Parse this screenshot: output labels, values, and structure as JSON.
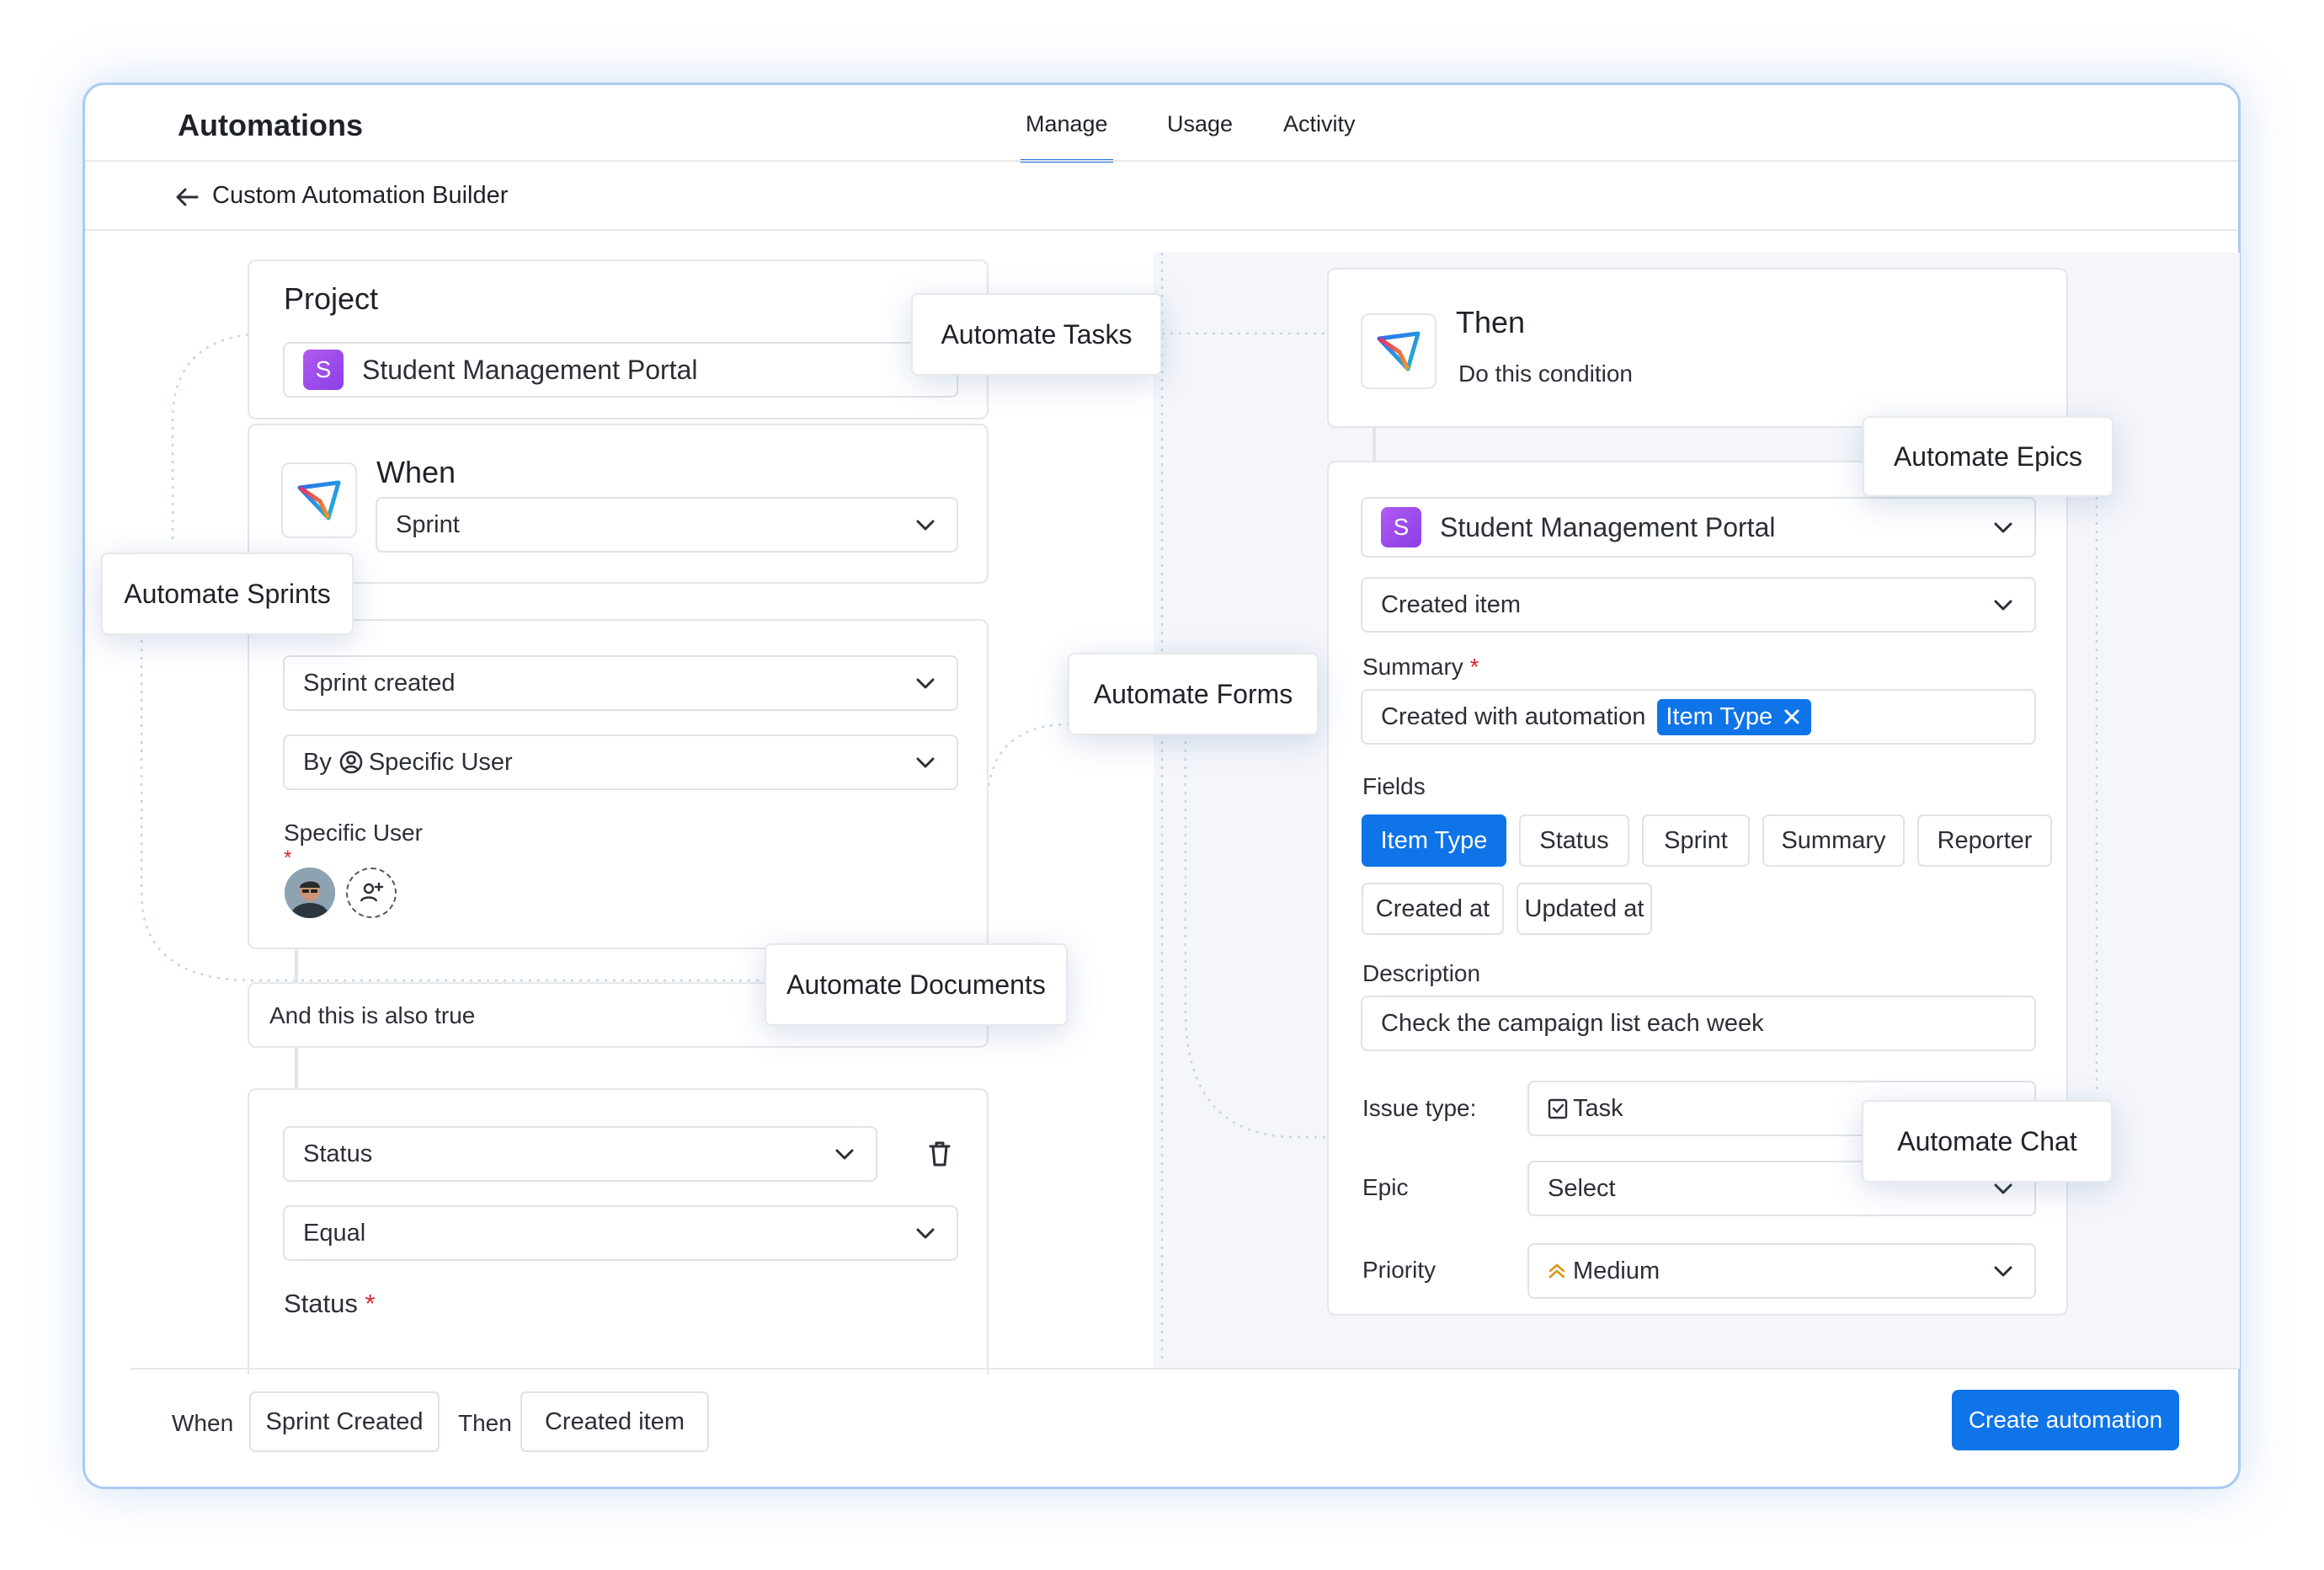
{
  "header": {
    "app_title": "Automations",
    "tabs": [
      "Manage",
      "Usage",
      "Activity"
    ],
    "active_tab": "Manage",
    "breadcrumb": "Custom Automation Builder"
  },
  "left": {
    "project_title": "Project",
    "project_name": "Student Management Portal",
    "project_badge": "S",
    "when_title": "When",
    "when_select": "Sprint",
    "trigger_select": "Sprint created",
    "by_prefix": "By",
    "by_user": "Specific User",
    "specific_user_label": "Specific User",
    "asterisk": "*",
    "and_also_true": "And this is also true",
    "status_select": "Status",
    "equal_select": "Equal",
    "status_label": "Status"
  },
  "right": {
    "then_title": "Then",
    "then_subtitle": "Do this condition",
    "project_name": "Student Management Portal",
    "project_badge": "S",
    "action_select": "Created item",
    "summary_label": "Summary",
    "summary_text": "Created with automation",
    "summary_token": "Item Type",
    "fields_label": "Fields",
    "field_chips": [
      "Item Type",
      "Status",
      "Sprint",
      "Summary",
      "Reporter",
      "Created at",
      "Updated at"
    ],
    "description_label": "Description",
    "description_value": "Check the campaign list each week",
    "issue_type_label": "Issue type:",
    "issue_type_value": "Task",
    "epic_label": "Epic",
    "epic_value": "Select",
    "priority_label": "Priority",
    "priority_value": "Medium"
  },
  "callouts": {
    "tasks": "Automate Tasks",
    "epics": "Automate Epics",
    "sprints": "Automate Sprints",
    "forms": "Automate Forms",
    "documents": "Automate Documents",
    "chat": "Automate Chat"
  },
  "footer": {
    "when_label": "When",
    "when_value": "Sprint Created",
    "then_label": "Then",
    "then_value": "Created item",
    "create_button": "Create automation"
  },
  "colors": {
    "accent": "#0e74e8",
    "badge": "#a24ff0",
    "required": "#d8262c",
    "priority_icon": "#d89a1c"
  }
}
